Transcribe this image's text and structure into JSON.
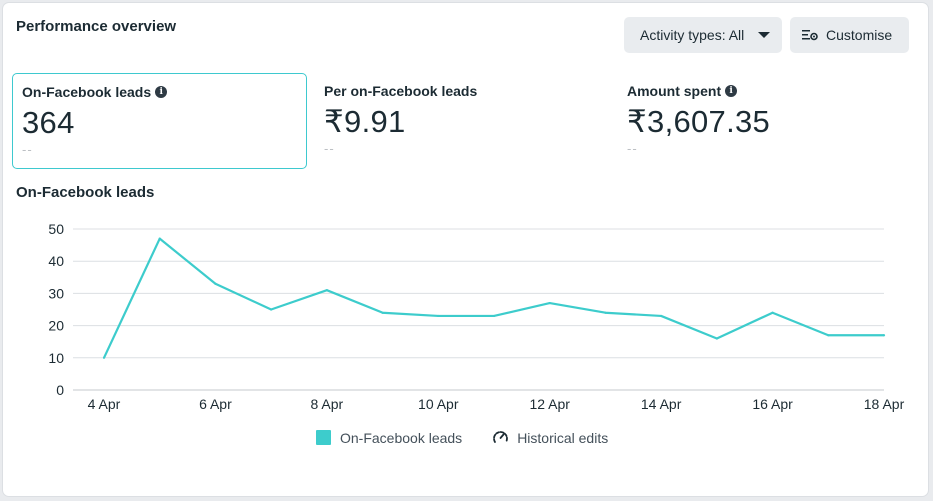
{
  "header": {
    "title": "Performance overview",
    "activity_button": "Activity types: All",
    "customise_button": "Customise"
  },
  "metrics": [
    {
      "label": "On-Facebook leads",
      "value": "364",
      "compare": "--",
      "has_info": true
    },
    {
      "label": "Per on-Facebook leads",
      "value": "₹9.91",
      "compare": "--",
      "has_info": false
    },
    {
      "label": "Amount spent",
      "value": "₹3,607.35",
      "compare": "--",
      "has_info": true
    }
  ],
  "chart_title": "On-Facebook leads",
  "legend": {
    "series_label": "On-Facebook leads",
    "edits_label": "Historical edits"
  },
  "colors": {
    "accent": "#3dcccc",
    "grid": "#dcdfe3",
    "axis_text": "#1c2b33"
  },
  "chart_data": {
    "type": "line",
    "x": [
      "4 Apr",
      "5 Apr",
      "6 Apr",
      "7 Apr",
      "8 Apr",
      "9 Apr",
      "10 Apr",
      "11 Apr",
      "12 Apr",
      "13 Apr",
      "14 Apr",
      "15 Apr",
      "16 Apr",
      "17 Apr",
      "18 Apr"
    ],
    "xticks": [
      "4 Apr",
      "6 Apr",
      "8 Apr",
      "10 Apr",
      "12 Apr",
      "14 Apr",
      "16 Apr",
      "18 Apr"
    ],
    "series": [
      {
        "name": "On-Facebook leads",
        "values": [
          10,
          47,
          33,
          25,
          31,
          24,
          23,
          23,
          27,
          24,
          23,
          16,
          24,
          17,
          17
        ]
      }
    ],
    "ylim": [
      0,
      50
    ],
    "yticks": [
      0,
      10,
      20,
      30,
      40,
      50
    ],
    "grid": true,
    "legend": "bottom"
  }
}
